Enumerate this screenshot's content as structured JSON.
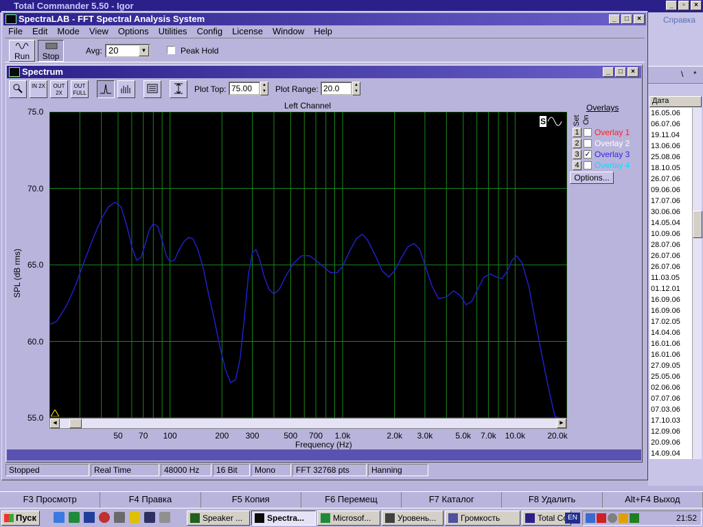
{
  "background_app": {
    "title": "Total Commander 5.50 - Igor",
    "help_menu": "Справка",
    "toolbar_marks": [
      "\\",
      "*"
    ],
    "date_column_header": "Дата",
    "dates": [
      "16.05.06",
      "06.07.06",
      "19.11.04",
      "13.06.06",
      "25.08.06",
      "18.10.05",
      "26.07.06",
      "09.06.06",
      "17.07.06",
      "30.06.06",
      "14.05.04",
      "10.09.06",
      "28.07.06",
      "26.07.06",
      "26.07.06",
      "11.03.05",
      "01.12.01",
      "16.09.06",
      "16.09.06",
      "17.02.05",
      "14.04.06",
      "16.01.06",
      "16.01.06",
      "27.09.05",
      "25.05.06",
      "02.06.06",
      "07.07.06",
      "07.03.06",
      "17.10.03",
      "12.09.06",
      "20.09.06",
      "14.09.04"
    ],
    "function_keys": [
      "F3 Просмотр",
      "F4 Правка",
      "F5 Копия",
      "F6 Перемещ",
      "F7 Каталог",
      "F8 Удалить",
      "Alt+F4 Выход"
    ]
  },
  "app": {
    "title": "SpectraLAB - FFT Spectral Analysis System",
    "menu": [
      "File",
      "Edit",
      "Mode",
      "View",
      "Options",
      "Utilities",
      "Config",
      "License",
      "Window",
      "Help"
    ],
    "run_label": "Run",
    "stop_label": "Stop",
    "avg_label": "Avg:",
    "avg_value": "20",
    "peak_hold_label": "Peak Hold",
    "peak_hold_checked": false
  },
  "spectrum_window": {
    "title": "Spectrum",
    "tool_icons": [
      "zoom-icon",
      "zoom-in-2x-icon",
      "zoom-out-2x-icon",
      "zoom-out-full-icon",
      "line-plot-icon",
      "bar-plot-icon",
      "settings-icon",
      "autoscale-icon"
    ],
    "tool_texts": [
      "",
      "IN 2X",
      "OUT 2X",
      "OUT FULL",
      "",
      "",
      "",
      ""
    ],
    "plot_top_label": "Plot Top:",
    "plot_top_value": "75.00",
    "plot_range_label": "Plot Range:",
    "plot_range_value": "20.0"
  },
  "overlays": {
    "title": "Overlays",
    "set_label": "Set",
    "on_label": "On",
    "items": [
      {
        "num": "1",
        "label": "Overlay 1",
        "checked": false,
        "color": "#ff2020"
      },
      {
        "num": "2",
        "label": "Overlay 2",
        "checked": false,
        "color": "#ffffff"
      },
      {
        "num": "3",
        "label": "Overlay 3",
        "checked": true,
        "color": "#2a2ae0"
      },
      {
        "num": "4",
        "label": "Overlay 4",
        "checked": false,
        "color": "#00e0ff"
      }
    ],
    "options_label": "Options..."
  },
  "chart_data": {
    "type": "line",
    "title": "Left Channel",
    "xlabel": "Frequency (Hz)",
    "ylabel": "SPL (dB rms)",
    "x_scale": "log",
    "xlim": [
      20,
      20000
    ],
    "ylim": [
      55,
      75
    ],
    "y_ticks": [
      "75.0",
      "70.0",
      "65.0",
      "60.0",
      "55.0"
    ],
    "x_ticks": [
      {
        "v": 50,
        "label": "50"
      },
      {
        "v": 70,
        "label": "70"
      },
      {
        "v": 100,
        "label": "100"
      },
      {
        "v": 200,
        "label": "200"
      },
      {
        "v": 300,
        "label": "300"
      },
      {
        "v": 500,
        "label": "500"
      },
      {
        "v": 700,
        "label": "700"
      },
      {
        "v": 1000,
        "label": "1.0k"
      },
      {
        "v": 2000,
        "label": "2.0k"
      },
      {
        "v": 3000,
        "label": "3.0k"
      },
      {
        "v": 5000,
        "label": "5.0k"
      },
      {
        "v": 7000,
        "label": "7.0k"
      },
      {
        "v": 10000,
        "label": "10.0k"
      },
      {
        "v": 20000,
        "label": "20.0k"
      }
    ],
    "grid": true,
    "line_color": "#2020c8",
    "grid_color": "#1a8a1a",
    "series": [
      {
        "points": [
          [
            20,
            61.1
          ],
          [
            22,
            61.3
          ],
          [
            25,
            62.3
          ],
          [
            28,
            63.5
          ],
          [
            32,
            65.3
          ],
          [
            36,
            66.8
          ],
          [
            40,
            68.0
          ],
          [
            44,
            68.8
          ],
          [
            48,
            69.1
          ],
          [
            52,
            68.8
          ],
          [
            56,
            67.6
          ],
          [
            60,
            66.2
          ],
          [
            64,
            65.3
          ],
          [
            68,
            65.5
          ],
          [
            72,
            66.4
          ],
          [
            76,
            67.3
          ],
          [
            80,
            67.7
          ],
          [
            85,
            67.5
          ],
          [
            90,
            66.6
          ],
          [
            95,
            65.6
          ],
          [
            100,
            65.2
          ],
          [
            106,
            65.3
          ],
          [
            112,
            65.9
          ],
          [
            120,
            66.5
          ],
          [
            128,
            66.8
          ],
          [
            136,
            66.7
          ],
          [
            145,
            66.0
          ],
          [
            155,
            64.9
          ],
          [
            165,
            63.4
          ],
          [
            180,
            61.5
          ],
          [
            195,
            59.6
          ],
          [
            210,
            58.1
          ],
          [
            225,
            57.3
          ],
          [
            240,
            57.5
          ],
          [
            255,
            58.9
          ],
          [
            270,
            61.6
          ],
          [
            285,
            64.4
          ],
          [
            300,
            65.8
          ],
          [
            315,
            66.0
          ],
          [
            330,
            65.4
          ],
          [
            350,
            64.3
          ],
          [
            375,
            63.4
          ],
          [
            400,
            63.1
          ],
          [
            430,
            63.4
          ],
          [
            470,
            64.3
          ],
          [
            520,
            65.1
          ],
          [
            580,
            65.6
          ],
          [
            640,
            65.6
          ],
          [
            700,
            65.3
          ],
          [
            770,
            64.9
          ],
          [
            850,
            64.5
          ],
          [
            930,
            64.5
          ],
          [
            1000,
            64.9
          ],
          [
            1100,
            65.9
          ],
          [
            1200,
            66.7
          ],
          [
            1300,
            67.0
          ],
          [
            1400,
            66.6
          ],
          [
            1550,
            65.6
          ],
          [
            1700,
            64.6
          ],
          [
            1850,
            64.2
          ],
          [
            2000,
            64.6
          ],
          [
            2200,
            65.5
          ],
          [
            2400,
            66.2
          ],
          [
            2600,
            66.4
          ],
          [
            2800,
            66.0
          ],
          [
            3000,
            65.0
          ],
          [
            3300,
            63.6
          ],
          [
            3600,
            62.8
          ],
          [
            4000,
            62.9
          ],
          [
            4400,
            63.3
          ],
          [
            4800,
            63.0
          ],
          [
            5200,
            62.4
          ],
          [
            5600,
            62.6
          ],
          [
            6000,
            63.3
          ],
          [
            6600,
            64.2
          ],
          [
            7200,
            64.4
          ],
          [
            7800,
            64.2
          ],
          [
            8400,
            64.1
          ],
          [
            9000,
            64.6
          ],
          [
            9600,
            65.3
          ],
          [
            10200,
            65.6
          ],
          [
            11000,
            65.1
          ],
          [
            12000,
            63.6
          ],
          [
            13000,
            61.5
          ],
          [
            14000,
            59.6
          ],
          [
            15000,
            57.9
          ],
          [
            16000,
            56.4
          ],
          [
            17000,
            55.1
          ],
          [
            18000,
            55.0
          ],
          [
            20000,
            55.0
          ]
        ]
      }
    ]
  },
  "statusbar": [
    "Stopped",
    "Real Time",
    "48000 Hz",
    "16 Bit",
    "Mono",
    "FFT 32768 pts",
    "Hanning"
  ],
  "taskbar": {
    "start_label": "Пуск",
    "tasks": [
      "Speaker ...",
      "Spectra...",
      "Microsof...",
      "Уровень...",
      "Громкость",
      "Total Co..."
    ],
    "active_task": 1,
    "lang": "EN",
    "clock": "21:52"
  }
}
